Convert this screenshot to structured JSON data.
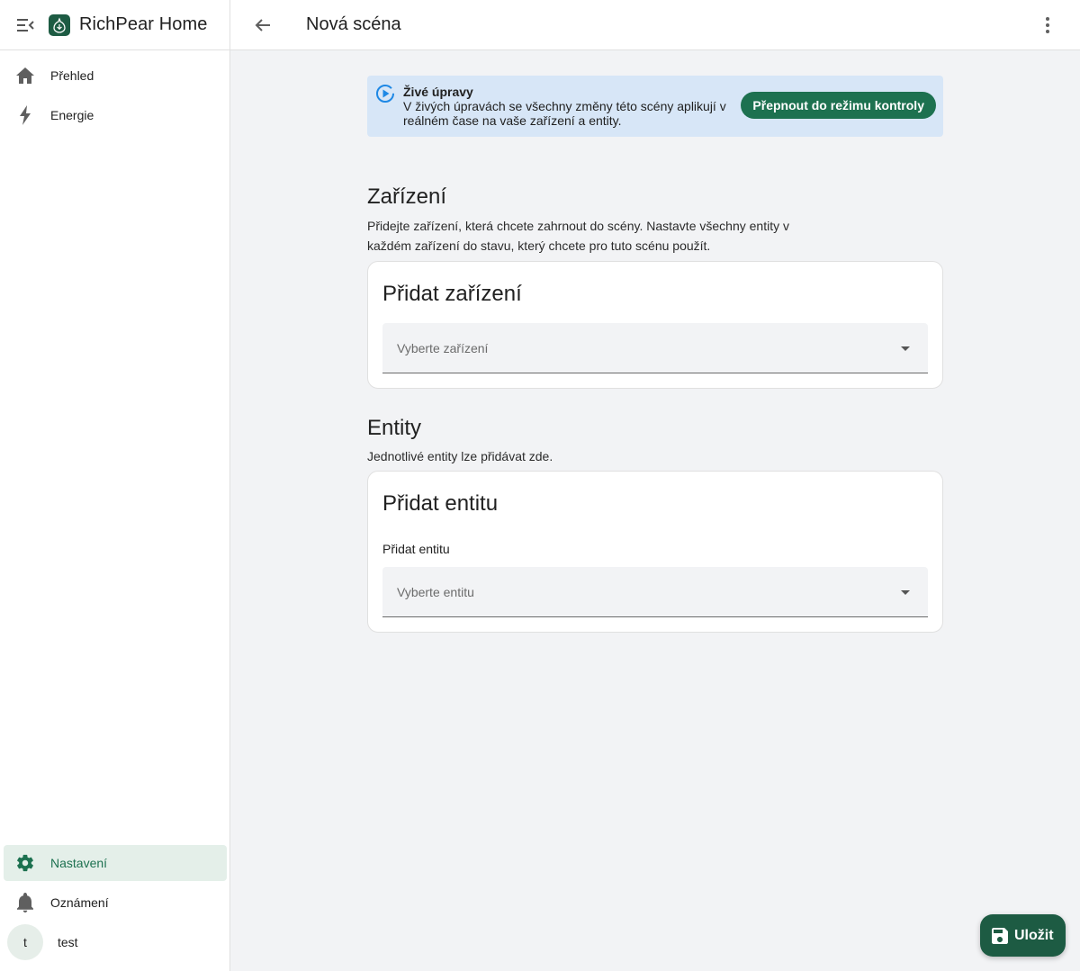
{
  "app": {
    "title": "RichPear Home"
  },
  "sidebar": {
    "items": [
      {
        "label": "Přehled",
        "icon": "home-icon"
      },
      {
        "label": "Energie",
        "icon": "lightning-bolt-icon"
      }
    ],
    "bottom_items": [
      {
        "label": "Nastavení",
        "icon": "gear-icon",
        "active": true
      },
      {
        "label": "Oznámení",
        "icon": "bell-icon"
      }
    ],
    "user": {
      "initial": "t",
      "name": "test"
    }
  },
  "header": {
    "title": "Nová scéna"
  },
  "alert": {
    "title": "Živé úpravy",
    "body_line1": "V živých úpravách se všechny změny této scény aplikují v",
    "body_line2": "reálném čase na vaše zařízení a entity.",
    "button_label": "Přepnout do režimu kontroly"
  },
  "devices": {
    "title": "Zařízení",
    "desc_line1": "Přidejte zařízení, která chcete zahrnout do scény. Nastavte všechny entity v",
    "desc_line2": "každém zařízení do stavu, který chcete pro tuto scénu použít.",
    "card_title": "Přidat zařízení",
    "select_placeholder": "Vyberte zařízení"
  },
  "entities": {
    "title": "Entity",
    "desc": "Jednotlivé entity lze přidávat zde.",
    "card_title": "Přidat entitu",
    "field_label": "Přidat entitu",
    "select_placeholder": "Vyberte entitu"
  },
  "fab": {
    "label": "Uložit"
  },
  "colors": {
    "primary": "#1d7150",
    "primary_dark": "#1d5b43",
    "alert_bg": "#d7e6f7",
    "alert_icon": "#1e88e5"
  }
}
